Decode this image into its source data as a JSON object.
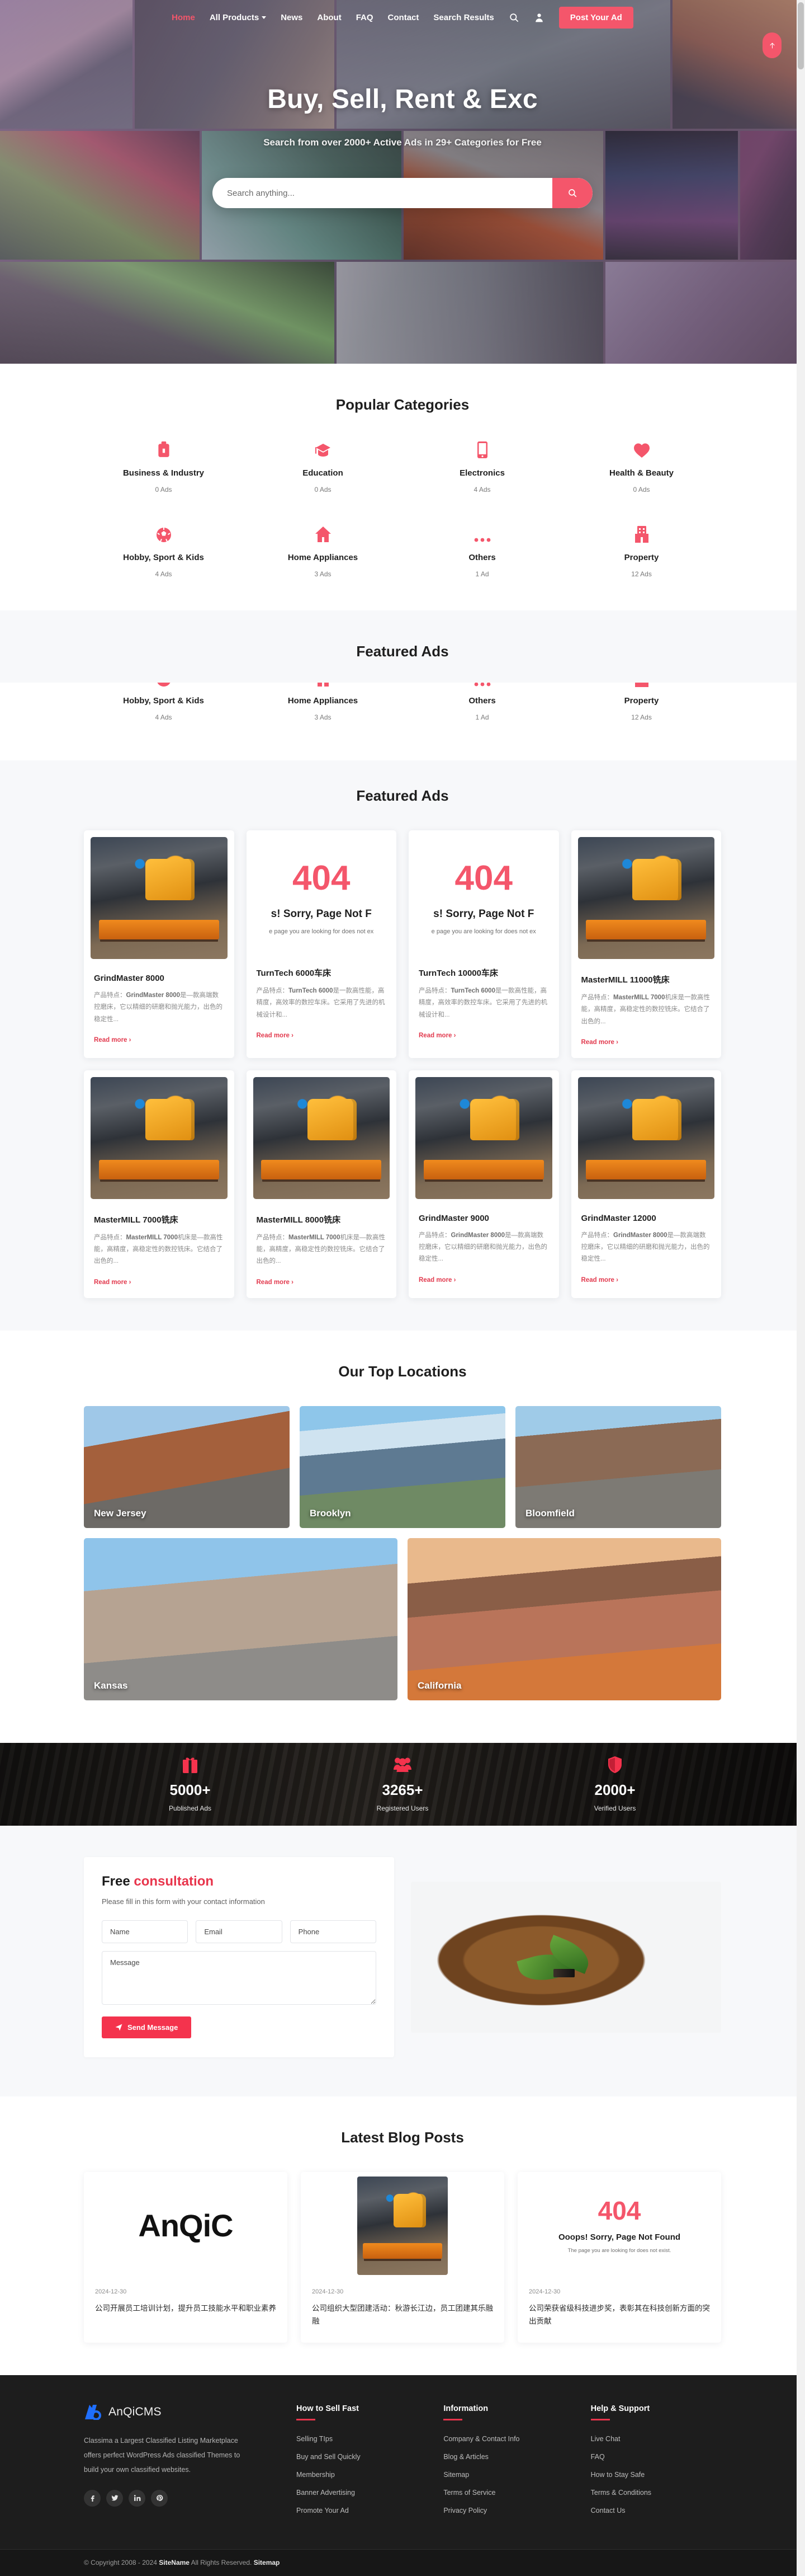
{
  "nav": {
    "items": [
      {
        "label": "Home",
        "active": true,
        "caret": false
      },
      {
        "label": "All Products",
        "active": false,
        "caret": true
      },
      {
        "label": "News",
        "active": false,
        "caret": false
      },
      {
        "label": "About",
        "active": false,
        "caret": false
      },
      {
        "label": "FAQ",
        "active": false,
        "caret": false
      },
      {
        "label": "Contact",
        "active": false,
        "caret": false
      },
      {
        "label": "Search Results",
        "active": false,
        "caret": false
      }
    ],
    "search_icon": "search-icon",
    "account_icon": "user-icon",
    "post_ad": "Post Your Ad"
  },
  "hero": {
    "title": "Buy, Sell, Rent & Exc",
    "subtitle": "Search from over 2000+ Active Ads in 29+ Categories for Free",
    "search_placeholder": "Search anything...",
    "search_value": ""
  },
  "categories": {
    "title": "Popular Categories",
    "items": [
      {
        "name": "Business & Industry",
        "count": "0 Ads",
        "icon": "briefcase-icon"
      },
      {
        "name": "Education",
        "count": "0 Ads",
        "icon": "graduation-cap-icon"
      },
      {
        "name": "Electronics",
        "count": "4 Ads",
        "icon": "mobile-phone-icon"
      },
      {
        "name": "Health & Beauty",
        "count": "0 Ads",
        "icon": "heart-icon"
      },
      {
        "name": "Hobby, Sport & Kids",
        "count": "4 Ads",
        "icon": "football-icon"
      },
      {
        "name": "Home Appliances",
        "count": "3 Ads",
        "icon": "home-icon"
      },
      {
        "name": "Others",
        "count": "1 Ad",
        "icon": "ellipsis-icon"
      },
      {
        "name": "Property",
        "count": "12 Ads",
        "icon": "building-icon"
      }
    ]
  },
  "featured_ghost": {
    "title": "Featured Ads",
    "items": [
      {
        "name": "Hobby, Sport & Kids",
        "count": "4 Ads",
        "icon": "football-icon"
      },
      {
        "name": "Home Appliances",
        "count": "3 Ads",
        "icon": "home-icon"
      },
      {
        "name": "Others",
        "count": "1 Ad",
        "icon": "ellipsis-icon"
      },
      {
        "name": "Property",
        "count": "12 Ads",
        "icon": "building-icon"
      }
    ],
    "scroll_top_icon": "arrow-up-icon"
  },
  "featured": {
    "title": "Featured Ads",
    "read_more": "Read more",
    "error_big": "404",
    "error_msg": "s! Sorry, Page Not F",
    "error_sub": "e page you are looking for does not ex",
    "cards": [
      {
        "type": "image",
        "title": "GrindMaster 8000",
        "desc_lead": "产品特点：",
        "desc_bold": "GrindMaster 8000",
        "desc": "是—款高端数控磨床，它以精细的研磨和抛光能力，出色的稳定性..."
      },
      {
        "type": "error",
        "title": "TurnTech 6000车床",
        "desc_lead": "产品特点：",
        "desc_bold": "TurnTech 6000",
        "desc": "是一款高性能，高精度，高效率的数控车床。它采用了先进的机械设计和..."
      },
      {
        "type": "error",
        "title": "TurnTech 10000车床",
        "desc_lead": "产品特点：",
        "desc_bold": "TurnTech 6000",
        "desc": "是一款高性能，高精度，高效率的数控车床。它采用了先进的机械设计和..."
      },
      {
        "type": "image",
        "title": "MasterMILL 11000铣床",
        "desc_lead": "产品特点：",
        "desc_bold": "MasterMILL 7000",
        "desc": "机床是一款高性能，高精度，高稳定性的数控铣床。它结合了出色的..."
      },
      {
        "type": "image",
        "title": "MasterMILL 7000铣床",
        "desc_lead": "产品特点：",
        "desc_bold": "MasterMILL 7000",
        "desc": "机床是—款高性能，高精度，高稳定性的数控铣床。它结合了出色的..."
      },
      {
        "type": "image",
        "title": "MasterMILL 8000铣床",
        "desc_lead": "产品特点：",
        "desc_bold": "MasterMILL 7000",
        "desc": "机床是—款高性能，高精度，高稳定性的数控铣床。它结合了出色的..."
      },
      {
        "type": "image",
        "title": "GrindMaster 9000",
        "desc_lead": "产品特点：",
        "desc_bold": "GrindMaster 8000",
        "desc": "是—款高端数控磨床，它以精细的研磨和抛光能力，出色的稳定性..."
      },
      {
        "type": "image",
        "title": "GrindMaster 12000",
        "desc_lead": "产品特点：",
        "desc_bold": "GrindMaster 8000",
        "desc": "是—款高端数控磨床，它以精细的研磨和抛光能力，出色的稳定性..."
      }
    ]
  },
  "locations": {
    "title": "Our Top Locations",
    "row1": [
      {
        "name": "New Jersey",
        "style": "lc-nj"
      },
      {
        "name": "Brooklyn",
        "style": "lc-bk"
      },
      {
        "name": "Bloomfield",
        "style": "lc-bf"
      }
    ],
    "row2": [
      {
        "name": "Kansas",
        "style": "lc-ks"
      },
      {
        "name": "California",
        "style": "lc-ca"
      }
    ]
  },
  "stats": [
    {
      "value": "5000+",
      "label": "Published Ads",
      "icon": "gift-icon"
    },
    {
      "value": "3265+",
      "label": "Registered Users",
      "icon": "users-icon"
    },
    {
      "value": "2000+",
      "label": "Verified Users",
      "icon": "shield-icon"
    }
  ],
  "consultation": {
    "title_free": "Free",
    "title_accent": "consultation",
    "subtitle": "Please fill in this form with your contact information",
    "name_placeholder": "Name",
    "email_placeholder": "Email",
    "phone_placeholder": "Phone",
    "message_placeholder": "Message",
    "submit": "Send Message"
  },
  "blog": {
    "title": "Latest Blog Posts",
    "posts": [
      {
        "thumb": "logo",
        "logo_text": "AnQiC",
        "date": "2024-12-30",
        "title": "公司开展员工培训计划，提升员工技能水平和职业素养"
      },
      {
        "thumb": "machine",
        "date": "2024-12-30",
        "title": "公司组织大型团建活动：秋游长江边，员工团建其乐融融"
      },
      {
        "thumb": "error",
        "big": "404",
        "msg": "Ooops! Sorry, Page Not Found",
        "sub": "The page you are looking for does not exist.",
        "date": "2024-12-30",
        "title": "公司荣获省级科技进步奖，表彰其在科技创新方面的突出贡献"
      }
    ]
  },
  "footer": {
    "brand": "AnQiCMS",
    "about": "Classima a Largest Classified Listing Marketplace offers perfect WordPress Ads classified Themes to build your own classified websites.",
    "socials": [
      "facebook-icon",
      "twitter-icon",
      "linkedin-icon",
      "pinterest-icon"
    ],
    "columns": [
      {
        "head": "How to Sell Fast",
        "links": [
          "Selling TIps",
          "Buy and Sell Quickly",
          "Membership",
          "Banner Advertising",
          "Promote Your Ad"
        ]
      },
      {
        "head": "Information",
        "links": [
          "Company & Contact Info",
          "Blog & Articles",
          "Sitemap",
          "Terms of Service",
          "Privacy Policy"
        ]
      },
      {
        "head": "Help & Support",
        "links": [
          "Live Chat",
          "FAQ",
          "How to Stay Safe",
          "Terms & Conditions",
          "Contact Us"
        ]
      }
    ],
    "copyright_pre": "© Copyright 2008 - 2024 ",
    "copyright_brand": "SiteName",
    "copyright_mid": " All Rights Reserved. ",
    "copyright_link": "Sitemap"
  },
  "colors": {
    "accent": "#f4566b",
    "accent_dark": "#e8354c",
    "dark": "#1d1d1d"
  }
}
